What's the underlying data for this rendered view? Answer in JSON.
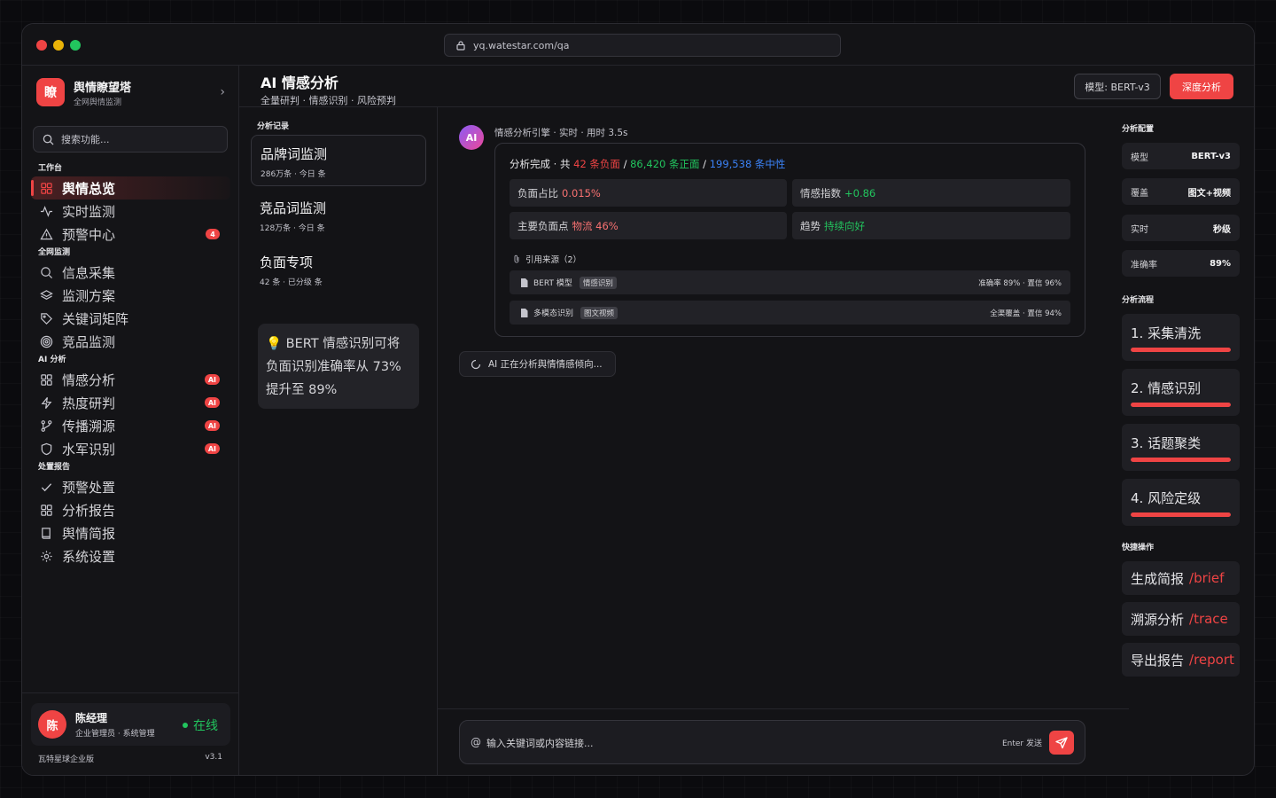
{
  "browser": {
    "url": "yq.watestar.com/qa"
  },
  "brand": {
    "logo_char": "瞭",
    "title": "舆情瞭望塔",
    "subtitle": "全网舆情监测"
  },
  "search": {
    "placeholder": "搜索功能..."
  },
  "nav": {
    "workbench": {
      "label": "工作台",
      "items": [
        {
          "label": "舆情总览"
        },
        {
          "label": "实时监测"
        },
        {
          "label": "预警中心",
          "badge": "4"
        }
      ]
    },
    "monitor": {
      "label": "全网监测",
      "items": [
        {
          "label": "信息采集"
        },
        {
          "label": "监测方案"
        },
        {
          "label": "关键词矩阵"
        },
        {
          "label": "竞品监测"
        }
      ]
    },
    "ai": {
      "label": "AI 分析",
      "items": [
        {
          "label": "情感分析",
          "badge": "AI"
        },
        {
          "label": "热度研判",
          "badge": "AI"
        },
        {
          "label": "传播溯源",
          "badge": "AI"
        },
        {
          "label": "水军识别",
          "badge": "AI"
        }
      ]
    },
    "report": {
      "label": "处置报告",
      "items": [
        {
          "label": "预警处置"
        },
        {
          "label": "分析报告"
        },
        {
          "label": "舆情简报"
        },
        {
          "label": "系统设置"
        }
      ]
    }
  },
  "user": {
    "avatar": "陈",
    "name": "陈经理",
    "role": "企业管理员 · 系统管理",
    "status": "在线"
  },
  "footer": {
    "edition": "瓦特星球企业版",
    "version": "v3.1"
  },
  "header": {
    "title": "AI 情感分析",
    "subtitle": "全量研判 · 情感识别 · 风险预判",
    "model_chip": "模型: BERT-v3",
    "action": "深度分析"
  },
  "history": {
    "label": "分析记录",
    "items": [
      {
        "title": "品牌词监测",
        "meta": "286万条 · 今日 条"
      },
      {
        "title": "竞品词监测",
        "meta": "128万条 · 今日 条"
      },
      {
        "title": "负面专项",
        "meta": "42 条 · 已分级 条"
      }
    ],
    "tip": "💡 BERT 情感识别可将负面识别准确率从 73% 提升至 89%"
  },
  "message": {
    "avatar": "AI",
    "meta": "情感分析引擎 · 实时 · 用时 3.5s",
    "summary": {
      "prefix": "分析完成 · 共",
      "negative": "42 条负面",
      "sep1": "/",
      "positive": "86,420 条正面",
      "sep2": "/",
      "neutral": "199,538 条中性"
    },
    "stats": [
      {
        "label": "负面占比",
        "value": "0.015%"
      },
      {
        "label": "情感指数",
        "value": "+0.86"
      },
      {
        "label": "主要负面点",
        "value": "物流 46%"
      },
      {
        "label": "趋势",
        "value": "持续向好"
      }
    ],
    "refs_label": "引用来源（2）",
    "refs": [
      {
        "name": "BERT 模型",
        "tag": "情感识别",
        "right": "准确率 89% · 置信 96%"
      },
      {
        "name": "多模态识别",
        "tag": "图文视频",
        "right": "全渠覆盖 · 置信 94%"
      }
    ],
    "typing": "AI 正在分析舆情情感倾向..."
  },
  "composer": {
    "at": "@",
    "placeholder": "输入关键词或内容链接...",
    "hint": "Enter 发送"
  },
  "config": {
    "label": "分析配置",
    "rows": [
      {
        "key": "模型",
        "value": "BERT-v3"
      },
      {
        "key": "覆盖",
        "value": "图文+视频"
      },
      {
        "key": "实时",
        "value": "秒级"
      },
      {
        "key": "准确率",
        "value": "89%"
      }
    ]
  },
  "flow": {
    "label": "分析流程",
    "steps": [
      {
        "title": "1. 采集清洗",
        "progress": 1.0
      },
      {
        "title": "2. 情感识别",
        "progress": 1.0
      },
      {
        "title": "3. 话题聚类",
        "progress": 1.0
      },
      {
        "title": "4. 风险定级",
        "progress": 1.0
      }
    ]
  },
  "quick": {
    "label": "快捷操作",
    "items": [
      {
        "label": "生成简报",
        "cmd": "/brief"
      },
      {
        "label": "溯源分析",
        "cmd": "/trace"
      },
      {
        "label": "导出报告",
        "cmd": "/report"
      }
    ]
  },
  "colors": {
    "accent": "#ef4444",
    "positive": "#22c55e",
    "neutral": "#3b82f6"
  }
}
